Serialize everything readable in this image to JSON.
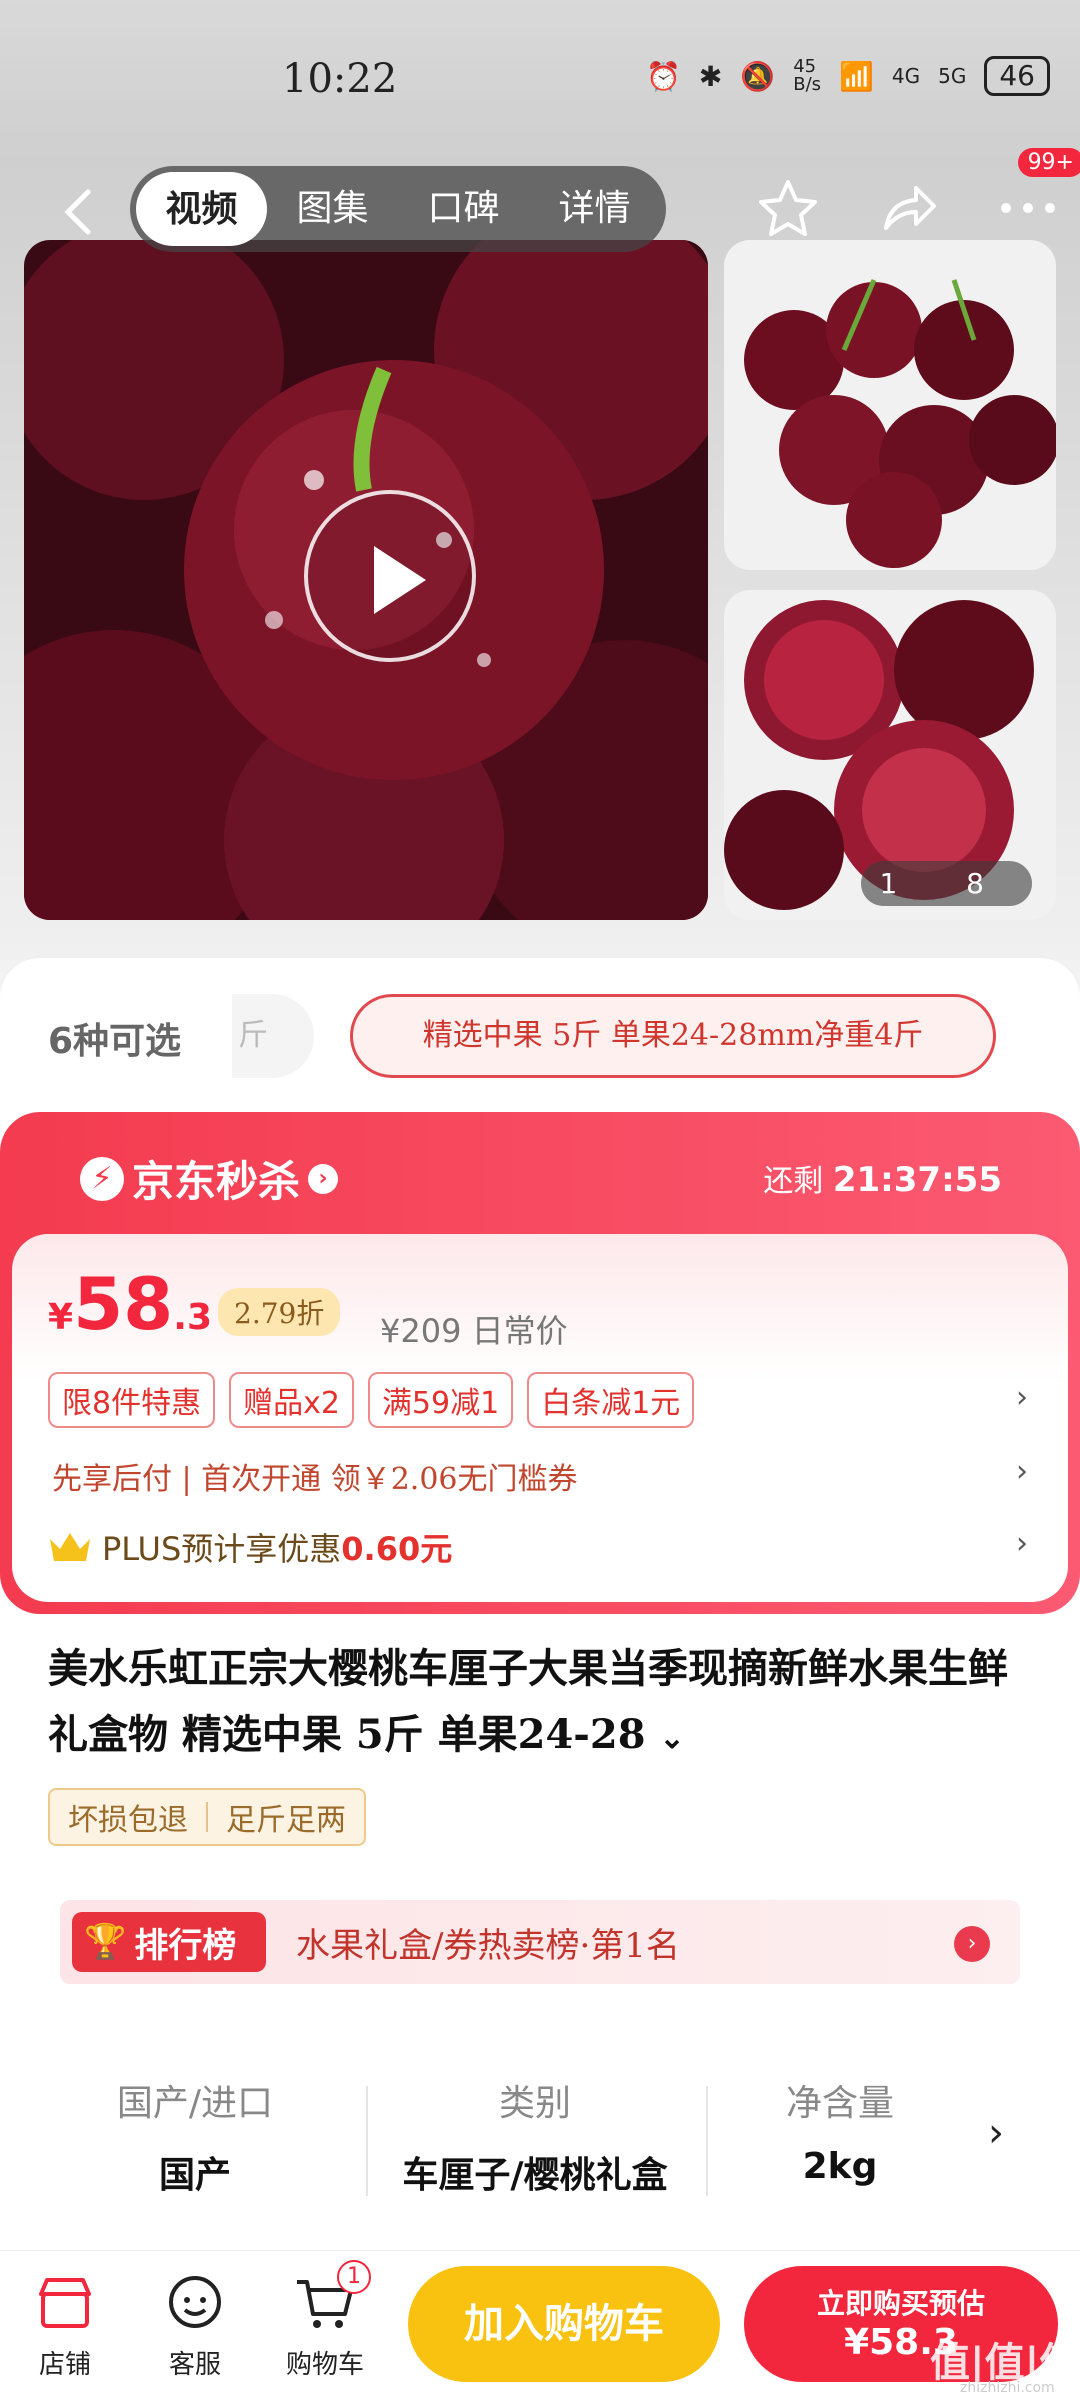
{
  "status_bar": {
    "time": "10:22",
    "net_speed": "45\nB/s",
    "signal_4g": "4G",
    "signal_5g": "5G",
    "battery": "46"
  },
  "nav": {
    "tabs": [
      "视频",
      "图集",
      "口碑",
      "详情"
    ],
    "active_tab": 0,
    "more_badge": "99+"
  },
  "gallery": {
    "image_counter": "1  8"
  },
  "options": {
    "count_label": "6种可选",
    "ghost_label": "斤",
    "selected": "精选中果 5斤 单果24-28mm净重4斤"
  },
  "flash_sale": {
    "brand": "京东秒杀",
    "countdown_label": "还剩",
    "countdown_value": "21:37:55",
    "price_currency": "¥",
    "price_int": "58",
    "price_dec": ".3",
    "discount": "2.79折",
    "orig_price": "¥209 日常价",
    "tags": [
      "限8件特惠",
      "赠品x2",
      "满59减1",
      "白条减1元"
    ],
    "pay_line": "先享后付 | 首次开通 领￥2.06无门槛券",
    "plus_prefix": "PLUS预计享优惠",
    "plus_value": "0.60元"
  },
  "product": {
    "title": "美水乐虹正宗大樱桃车厘子大果当季现摘新鲜水果生鲜礼盒物 精选中果 5斤 单果24-28",
    "guarantees": [
      "坏损包退",
      "足斤足两"
    ]
  },
  "ranking": {
    "badge": "排行榜",
    "text": "水果礼盒/券热卖榜·第1名"
  },
  "specs": [
    {
      "key": "国产/进口",
      "value": "国产"
    },
    {
      "key": "类别",
      "value": "车厘子/樱桃礼盒"
    },
    {
      "key": "净含量",
      "value": "2kg"
    }
  ],
  "bottom_bar": {
    "store": "店铺",
    "service": "客服",
    "cart": "购物车",
    "cart_badge": "1",
    "add_cart": "加入购物车",
    "buy_line1": "立即购买预估",
    "buy_line2": "¥58.3"
  },
  "watermark": {
    "main": "值|值|值",
    "sub": "zhizhizhi.com"
  },
  "colors": {
    "accent_red": "#f2263c",
    "cart_yellow": "#f9c211"
  }
}
